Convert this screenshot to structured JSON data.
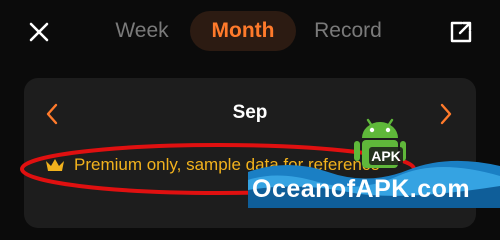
{
  "header": {
    "tabs": [
      {
        "label": "Week"
      },
      {
        "label": "Month"
      },
      {
        "label": "Record"
      }
    ],
    "active_tab": "Month"
  },
  "card": {
    "month_label": "Sep",
    "premium_notice": "Premium only, sample data for reference"
  },
  "watermark": {
    "text": "OceanofAPK.com",
    "badge": "APK"
  },
  "colors": {
    "accent": "#ff7a2b",
    "premium": "#f2b21d",
    "highlight": "#e01010"
  }
}
